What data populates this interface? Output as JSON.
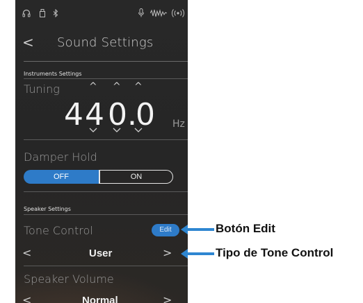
{
  "status_bar": {
    "icons": [
      "headphones-icon",
      "usb-memory-icon",
      "bluetooth-icon",
      "microphone-icon",
      "waveform-icon",
      "wireless-icon"
    ]
  },
  "nav": {
    "title": "Sound Settings",
    "back_glyph": "<"
  },
  "instruments_settings": {
    "section_label": "Instruments Settings",
    "tuning": {
      "label": "Tuning",
      "digits": [
        "4",
        "4",
        "0",
        ".",
        "0"
      ],
      "value": "440.0",
      "unit": "Hz"
    },
    "damper_hold": {
      "label": "Damper Hold",
      "options": [
        "OFF",
        "ON"
      ],
      "selected": "OFF"
    }
  },
  "speaker_settings": {
    "section_label": "Speaker Settings",
    "tone_control": {
      "label": "Tone Control",
      "edit_label": "Edit",
      "value": "User"
    },
    "speaker_volume": {
      "label": "Speaker Volume",
      "value": "Normal"
    }
  },
  "annotations": {
    "edit_button": "Botón Edit",
    "tone_type": "Tipo de Tone Control"
  },
  "colors": {
    "accent": "#2e7bc8",
    "background": "#282828",
    "callout_arrow": "#2e86d1"
  }
}
